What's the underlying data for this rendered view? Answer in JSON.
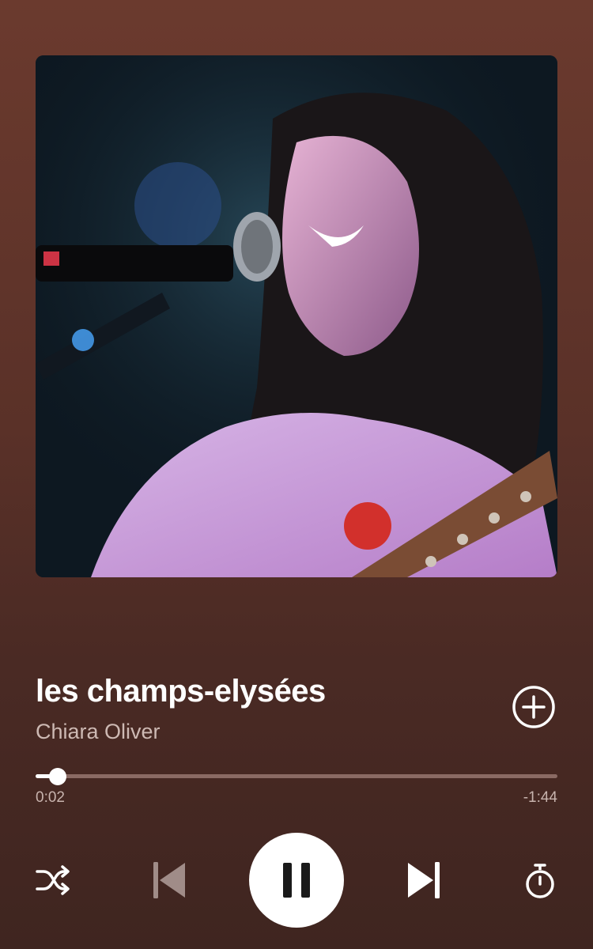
{
  "track": {
    "title": "les champs-elysées",
    "artist": "Chiara Oliver"
  },
  "playback": {
    "elapsed": "0:02",
    "remaining": "-1:44",
    "progress_fraction": 0.03,
    "state": "playing"
  },
  "controls": {
    "icons": [
      "shuffle-icon",
      "skip-previous-icon",
      "pause-icon",
      "skip-next-icon",
      "sleep-timer-icon"
    ],
    "add_icon": "add-circle-icon"
  },
  "colors": {
    "background_top": "#6b3a2e",
    "background_bottom": "#3f2520",
    "progress_track": "#8a6a63",
    "progress_fill": "#ffffff",
    "secondary_text": "#cdb9b3",
    "disabled_icon": "#a08c88"
  }
}
